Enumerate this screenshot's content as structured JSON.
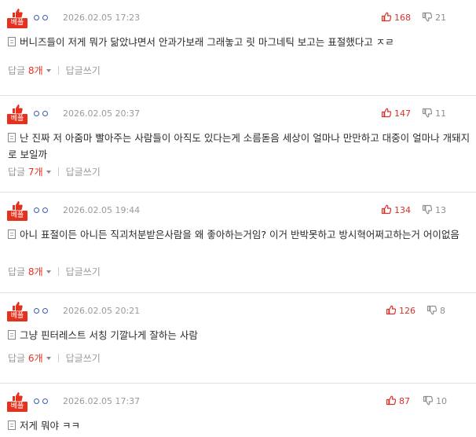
{
  "labels": {
    "best": "베플",
    "reply_prefix": "답글",
    "reply_suffix": "개",
    "write_reply": "답글쓰기"
  },
  "colors": {
    "accent": "#e4321f",
    "upvote": "#d6322b",
    "muted": "#9a9a9a"
  },
  "comments": [
    {
      "date": "2026.02.05 17:23",
      "up": "168",
      "down": "21",
      "text": "버니즈들이 저게 뭐가 닮았냐면서 안과가보래 그래놓고 릿 마그네틱 보고는 표절했다고 ㅈㄹ",
      "replies": "8"
    },
    {
      "date": "2026.02.05 20:37",
      "up": "147",
      "down": "11",
      "text": "난 진짜 저 아줌마 빨아주는 사람들이 아직도 있다는게 소름돋음 세상이 얼마나 만만하고 대중이 얼마나 개돼지로 보일까",
      "replies": "7"
    },
    {
      "date": "2026.02.05 19:44",
      "up": "134",
      "down": "13",
      "text": "아니 표절이든 아니든 직괴처분받은사람을 왜 좋아하는거임? 이거 반박못하고 방시혁어쩌고하는거 어이없음",
      "replies": "8"
    },
    {
      "date": "2026.02.05 20:21",
      "up": "126",
      "down": "8",
      "text": "그냥 핀터레스트 서칭 기깔나게 잘하는 사람",
      "replies": "6"
    },
    {
      "date": "2026.02.05 17:37",
      "up": "87",
      "down": "10",
      "text": "저게 뭐야 ㅋㅋ",
      "replies": ""
    }
  ]
}
